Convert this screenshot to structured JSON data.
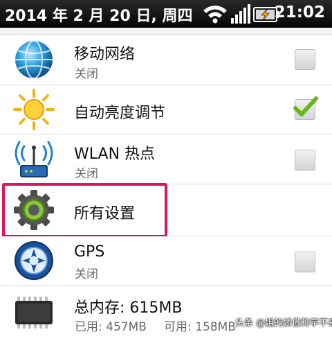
{
  "status_bar": {
    "date": "2014 年 2 月 20 日, 周四",
    "time": "21:02",
    "icons": [
      "wifi-icon",
      "signal-icon",
      "battery-charging-icon"
    ]
  },
  "settings": [
    {
      "title": "移动网络",
      "subtitle": "关闭",
      "icon": "globe-network-icon",
      "checked": false
    },
    {
      "title": "自动亮度调节",
      "subtitle": "",
      "icon": "sun-brightness-icon",
      "checked": true
    },
    {
      "title": "WLAN 热点",
      "subtitle": "关闭",
      "icon": "wlan-hotspot-icon",
      "checked": false
    },
    {
      "title": "所有设置",
      "subtitle": "",
      "icon": "gear-settings-icon"
    },
    {
      "title": "GPS",
      "subtitle": "关闭",
      "icon": "gps-compass-icon",
      "checked": false
    }
  ],
  "memory": {
    "title": "总内存: 615MB",
    "used": "已用: 457MB",
    "available": "可用: 158MB",
    "icon": "memory-chip-icon"
  },
  "highlight_color": "#e0135f",
  "check_color": "#6bb41c",
  "watermark": "头条 @姐的娇傲称学不来"
}
